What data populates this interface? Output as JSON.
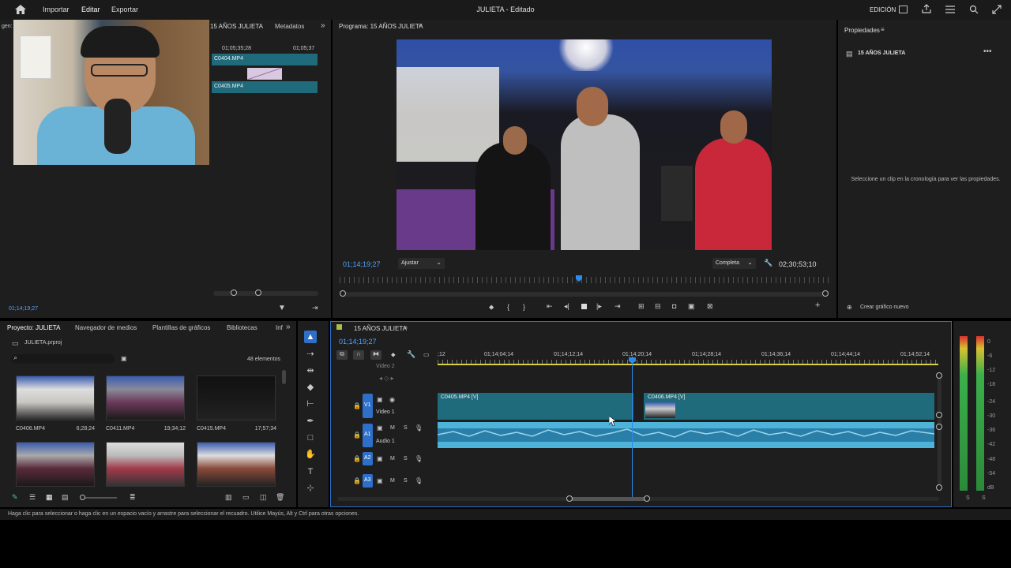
{
  "menubar": {
    "items": [
      "Importar",
      "Editar",
      "Exportar"
    ],
    "title": "JULIETA - Editado",
    "workspace": "EDICIÓN"
  },
  "source_panel": {
    "tabs": [
      "15 AÑOS JULIETA",
      "Metadatos"
    ],
    "left_label": "gen:",
    "times": [
      "01;05;35;28",
      "01;05;37"
    ],
    "clips": [
      "C0404.MP4",
      "C0405.MP4"
    ],
    "timecode": "01;14;19;27"
  },
  "program": {
    "title": "Programa: 15 AÑOS JULIETA",
    "timecode": "01;14;19;27",
    "fit": "Ajustar",
    "quality": "Completa",
    "duration": "02;30;53;10"
  },
  "properties": {
    "title": "Propiedades",
    "sequence": "15 AÑOS JULIETA",
    "hint": "Seleccione un clip en la cronología para ver las propiedades.",
    "new_graphic": "Crear gráfico nuevo"
  },
  "project": {
    "tabs": [
      "Proyecto: JULIETA",
      "Navegador de medios",
      "Plantillas de gráficos",
      "Bibliotecas",
      "Inf"
    ],
    "file": "JULIETA.prproj",
    "count": "48 elementos",
    "items": [
      {
        "name": "C0406.MP4",
        "dur": "6;28;24"
      },
      {
        "name": "C0411.MP4",
        "dur": "19;34;12"
      },
      {
        "name": "C0415.MP4",
        "dur": "17;57;34"
      }
    ]
  },
  "timeline": {
    "title": "15 AÑOS JULIETA",
    "timecode": "01;14;19;27",
    "ruler": ";12",
    "ticks": [
      "01;14;04;14",
      "01;14;12;14",
      "01;14;20;14",
      "01;14;28;14",
      "01;14;36;14",
      "01;14;44;14",
      "01;14;52;14"
    ],
    "tracks": {
      "v2": "Video 2",
      "v1": "V1",
      "v1_name": "Video 1",
      "a1": "A1",
      "a1_name": "Audio 1",
      "a2": "A2",
      "a3": "A3"
    },
    "clips": [
      "C0405.MP4 [V]",
      "C0406.MP4 [V]"
    ]
  },
  "meter": {
    "scale": [
      "0",
      "-6",
      "-12",
      "-18",
      "-24",
      "-30",
      "-36",
      "-42",
      "-48",
      "-54",
      "dB"
    ],
    "channels": [
      "S",
      "S"
    ]
  },
  "status": "Haga clic para seleccionar o haga clic en un espacio vacío y arrastre para seleccionar el recuadro. Utilice Mayús, Alt y Ctrl para otras opciones.",
  "colors": {
    "accent": "#2d8ceb",
    "clip": "#1f6b7c",
    "audio": "#4db3d9"
  }
}
